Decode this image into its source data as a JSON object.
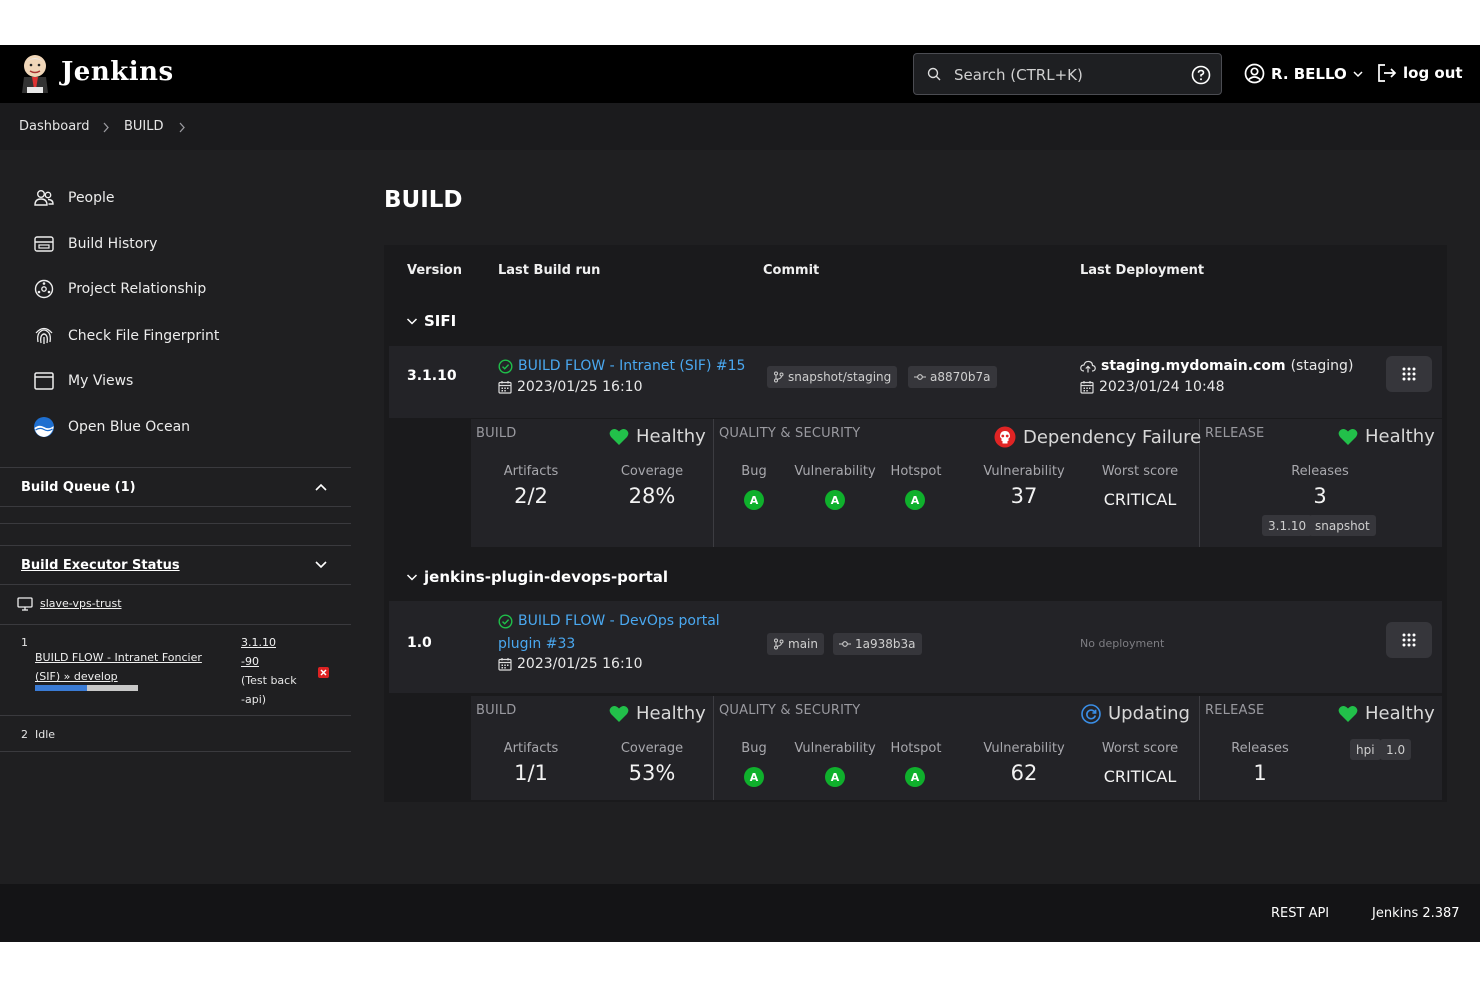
{
  "header": {
    "brand": "Jenkins",
    "search_placeholder": "Search (CTRL+K)",
    "user": "R. BELLO",
    "logout": "log out"
  },
  "breadcrumb": [
    "Dashboard",
    "BUILD"
  ],
  "sidebar": {
    "tasks": [
      {
        "label": "People",
        "icon": "people-icon"
      },
      {
        "label": "Build History",
        "icon": "build-history-icon"
      },
      {
        "label": "Project Relationship",
        "icon": "project-relationship-icon"
      },
      {
        "label": "Check File Fingerprint",
        "icon": "fingerprint-icon"
      },
      {
        "label": "My Views",
        "icon": "my-views-icon"
      },
      {
        "label": "Open Blue Ocean",
        "icon": "blue-ocean-icon"
      }
    ],
    "build_queue": {
      "title": "Build Queue (1)"
    },
    "executor": {
      "title": "Build Executor Status",
      "node": "slave-vps-trust",
      "exec1": {
        "number": "1",
        "job_line1": "BUILD FLOW - Intranet Foncier",
        "job_line2": "(SIF) » develop",
        "build_l1": "3.1.10",
        "build_l2": "-90",
        "build_l3": "(Test back",
        "build_l4": "-api)",
        "progress": 0.5
      },
      "exec2": {
        "number": "2",
        "status": "Idle"
      }
    }
  },
  "main": {
    "title": "BUILD",
    "columns": {
      "version": "Version",
      "last_build": "Last Build run",
      "commit": "Commit",
      "last_deployment": "Last Deployment"
    },
    "groups": [
      {
        "name": "SIFI",
        "version": "3.1.10",
        "build_link": "BUILD FLOW - Intranet (SIF) #15",
        "build_date": "2023/01/25 16:10",
        "branch": "snapshot/staging",
        "commit": "a8870b7a",
        "deploy_host": "staging.mydomain.com",
        "deploy_env": "(staging)",
        "deploy_date": "2023/01/24 10:48",
        "build_section": {
          "label": "BUILD",
          "status": "Healthy",
          "artifacts_label": "Artifacts",
          "artifacts": "2/2",
          "coverage_label": "Coverage",
          "coverage": "28%"
        },
        "quality_section": {
          "label": "QUALITY & SECURITY",
          "status": "Dependency Failure",
          "bug_label": "Bug",
          "bug": "A",
          "vuln_label": "Vulnerability",
          "vuln": "A",
          "hotspot_label": "Hotspot",
          "hotspot": "A",
          "dep_vuln_label": "Vulnerability",
          "dep_vuln": "37",
          "worst_label": "Worst score",
          "worst": "CRITICAL"
        },
        "release_section": {
          "label": "RELEASE",
          "status": "Healthy",
          "releases_label": "Releases",
          "releases": "3",
          "tags": [
            "3.1.10",
            "snapshot"
          ]
        }
      },
      {
        "name": "jenkins-plugin-devops-portal",
        "version": "1.0",
        "build_link_l1": "BUILD FLOW - DevOps portal",
        "build_link_l2": "plugin #33",
        "build_date": "2023/01/25 16:10",
        "branch": "main",
        "commit": "1a938b3a",
        "no_deploy": "No deployment",
        "build_section": {
          "label": "BUILD",
          "status": "Healthy",
          "artifacts_label": "Artifacts",
          "artifacts": "1/1",
          "coverage_label": "Coverage",
          "coverage": "53%"
        },
        "quality_section": {
          "label": "QUALITY & SECURITY",
          "status": "Updating",
          "bug_label": "Bug",
          "bug": "A",
          "vuln_label": "Vulnerability",
          "vuln": "A",
          "hotspot_label": "Hotspot",
          "hotspot": "A",
          "dep_vuln_label": "Vulnerability",
          "dep_vuln": "62",
          "worst_label": "Worst score",
          "worst": "CRITICAL"
        },
        "release_section": {
          "label": "RELEASE",
          "status": "Healthy",
          "releases_label": "Releases",
          "releases": "1",
          "tags": [
            "hpi",
            "1.0"
          ]
        }
      }
    ]
  },
  "footer": {
    "rest_api": "REST API",
    "version": "Jenkins 2.387"
  },
  "colors": {
    "header_bg": "#000000",
    "page_bg": "#1f1f21",
    "link": "#4aa8f0",
    "healthy": "#22c04a",
    "grade": "#0fb02c",
    "failure": "#e02424",
    "updating": "#3a8ee6"
  }
}
